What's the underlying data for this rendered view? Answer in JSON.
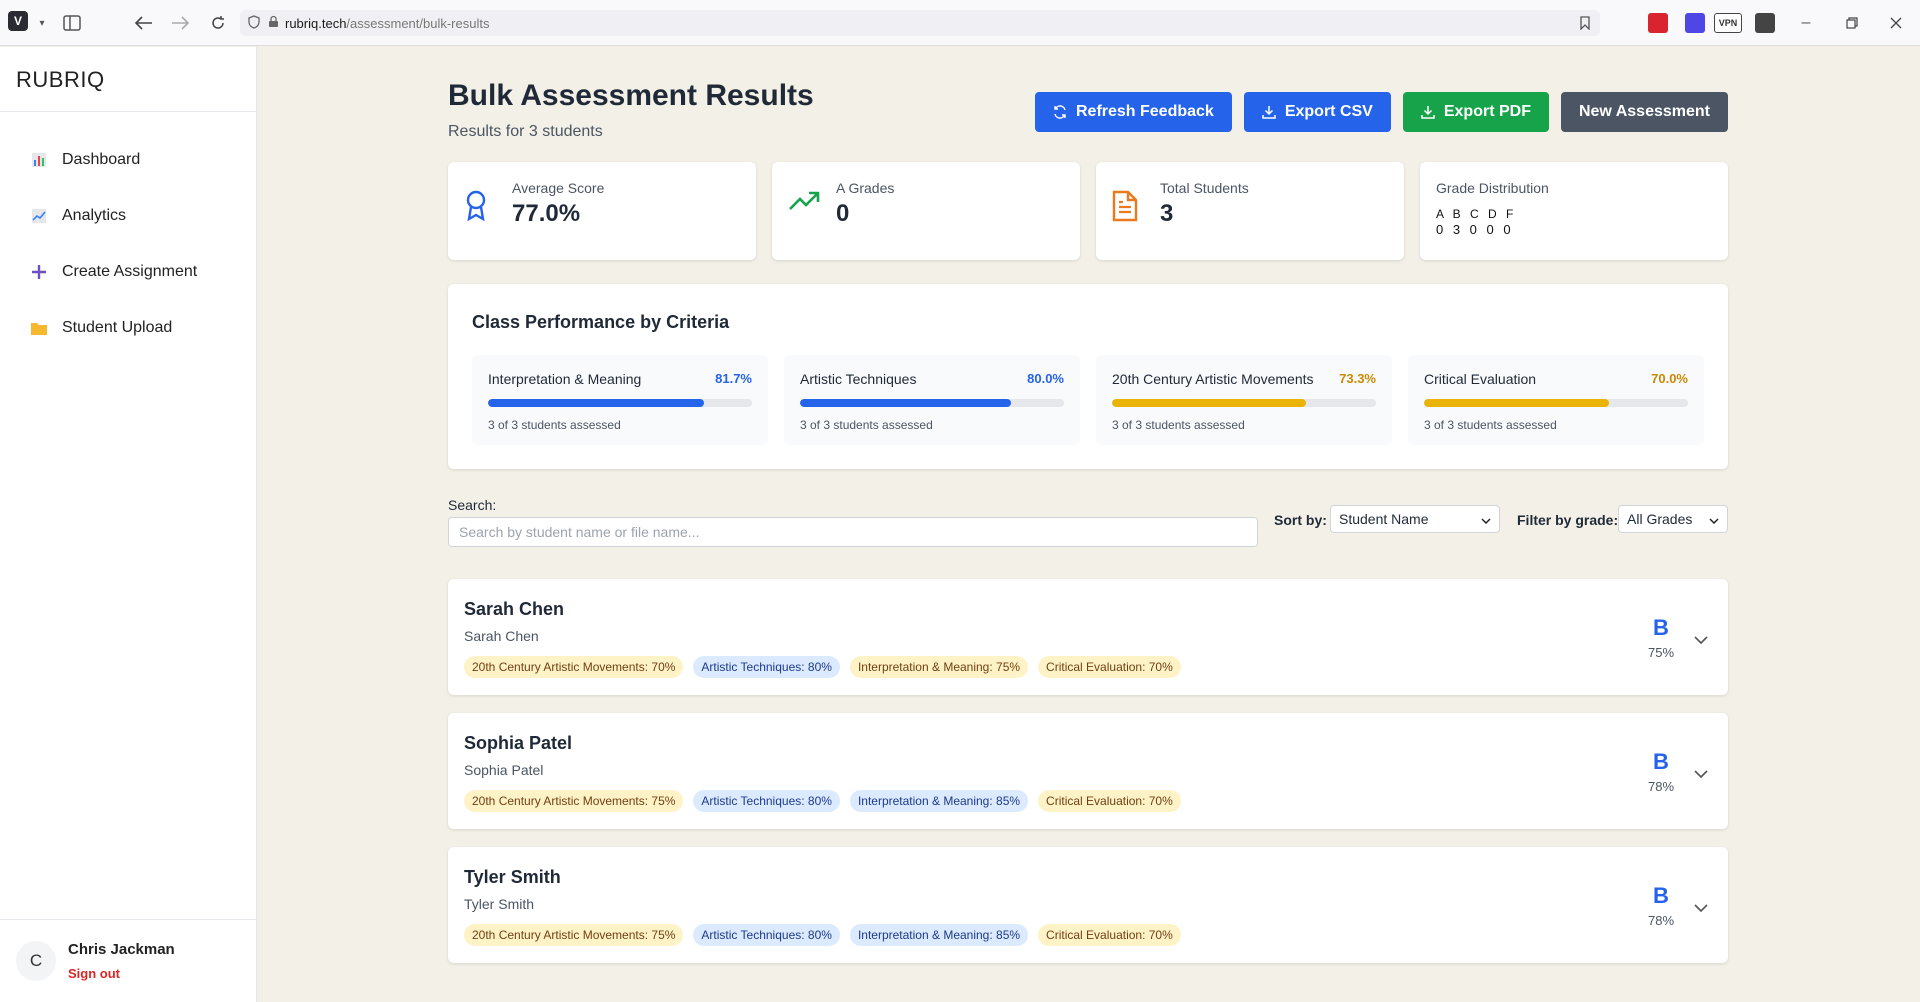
{
  "browser": {
    "url_host": "rubriq.tech",
    "url_path": "/assessment/bulk-results"
  },
  "sidebar": {
    "brand": "RUBRIQ",
    "items": [
      {
        "label": "Dashboard",
        "icon": "bar-chart-icon"
      },
      {
        "label": "Analytics",
        "icon": "line-chart-icon"
      },
      {
        "label": "Create Assignment",
        "icon": "plus-icon"
      },
      {
        "label": "Student Upload",
        "icon": "folder-icon"
      }
    ],
    "user": {
      "initial": "C",
      "name": "Chris Jackman",
      "signout": "Sign out"
    }
  },
  "header": {
    "title": "Bulk Assessment Results",
    "subtitle": "Results for 3 students",
    "buttons": {
      "refresh": "Refresh Feedback",
      "csv": "Export CSV",
      "pdf": "Export PDF",
      "new": "New Assessment"
    }
  },
  "stats": {
    "average": {
      "label": "Average Score",
      "value": "77.0%"
    },
    "a_grades": {
      "label": "A Grades",
      "value": "0"
    },
    "total": {
      "label": "Total Students",
      "value": "3"
    },
    "distribution": {
      "label": "Grade Distribution",
      "letters": "A B C D F",
      "counts": "0 3 0 0 0"
    }
  },
  "performance": {
    "title": "Class Performance by Criteria",
    "criteria": [
      {
        "name": "Interpretation & Meaning",
        "pct": "81.7%",
        "value": 81.7,
        "note": "3 of 3 students assessed",
        "color": "#2563eb"
      },
      {
        "name": "Artistic Techniques",
        "pct": "80.0%",
        "value": 80.0,
        "note": "3 of 3 students assessed",
        "color": "#2563eb"
      },
      {
        "name": "20th Century Artistic Movements",
        "pct": "73.3%",
        "value": 73.3,
        "note": "3 of 3 students assessed",
        "color": "#eab308"
      },
      {
        "name": "Critical Evaluation",
        "pct": "70.0%",
        "value": 70.0,
        "note": "3 of 3 students assessed",
        "color": "#eab308"
      }
    ]
  },
  "filters": {
    "search_label": "Search:",
    "search_placeholder": "Search by student name or file name...",
    "search_value": "",
    "sort_label": "Sort by:",
    "sort_value": "Student Name",
    "grade_label": "Filter by grade:",
    "grade_value": "All Grades"
  },
  "students": [
    {
      "name": "Sarah Chen",
      "file": "Sarah Chen",
      "grade": "B",
      "pct": "75%",
      "tags": [
        {
          "text": "20th Century Artistic Movements: 70%",
          "tone": "y"
        },
        {
          "text": "Artistic Techniques: 80%",
          "tone": "b"
        },
        {
          "text": "Interpretation & Meaning: 75%",
          "tone": "y"
        },
        {
          "text": "Critical Evaluation: 70%",
          "tone": "y"
        }
      ]
    },
    {
      "name": "Sophia Patel",
      "file": "Sophia Patel",
      "grade": "B",
      "pct": "78%",
      "tags": [
        {
          "text": "20th Century Artistic Movements: 75%",
          "tone": "y"
        },
        {
          "text": "Artistic Techniques: 80%",
          "tone": "b"
        },
        {
          "text": "Interpretation & Meaning: 85%",
          "tone": "b"
        },
        {
          "text": "Critical Evaluation: 70%",
          "tone": "y"
        }
      ]
    },
    {
      "name": "Tyler Smith",
      "file": "Tyler Smith",
      "grade": "B",
      "pct": "78%",
      "tags": [
        {
          "text": "20th Century Artistic Movements: 75%",
          "tone": "y"
        },
        {
          "text": "Artistic Techniques: 80%",
          "tone": "b"
        },
        {
          "text": "Interpretation & Meaning: 85%",
          "tone": "b"
        },
        {
          "text": "Critical Evaluation: 70%",
          "tone": "y"
        }
      ]
    }
  ]
}
